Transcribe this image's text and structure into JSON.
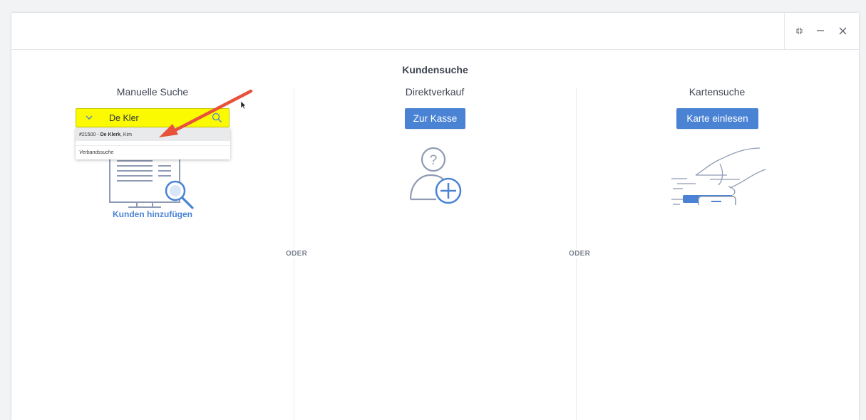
{
  "page": {
    "title": "Kundensuche"
  },
  "columns": {
    "manual": {
      "title": "Manuelle Suche",
      "search_value": "De Kler",
      "results": [
        {
          "prefix": "#21500 - ",
          "name": "De Klerk",
          "suffix": ", Kim"
        }
      ],
      "secondary_option": "Verbandssuche",
      "link": "Kunden hinzufügen"
    },
    "direct": {
      "title": "Direktverkauf",
      "button": "Zur Kasse"
    },
    "card": {
      "title": "Kartensuche",
      "button": "Karte einlesen"
    }
  },
  "separators": {
    "label": "ODER"
  },
  "window_controls": [
    "expand-icon",
    "minimize-icon",
    "close-icon"
  ],
  "colors": {
    "accent": "#4a83d4",
    "search_highlight": "#fbfa00",
    "annotation_arrow": "#e8513a",
    "icon_line": "#8f9bb4"
  }
}
